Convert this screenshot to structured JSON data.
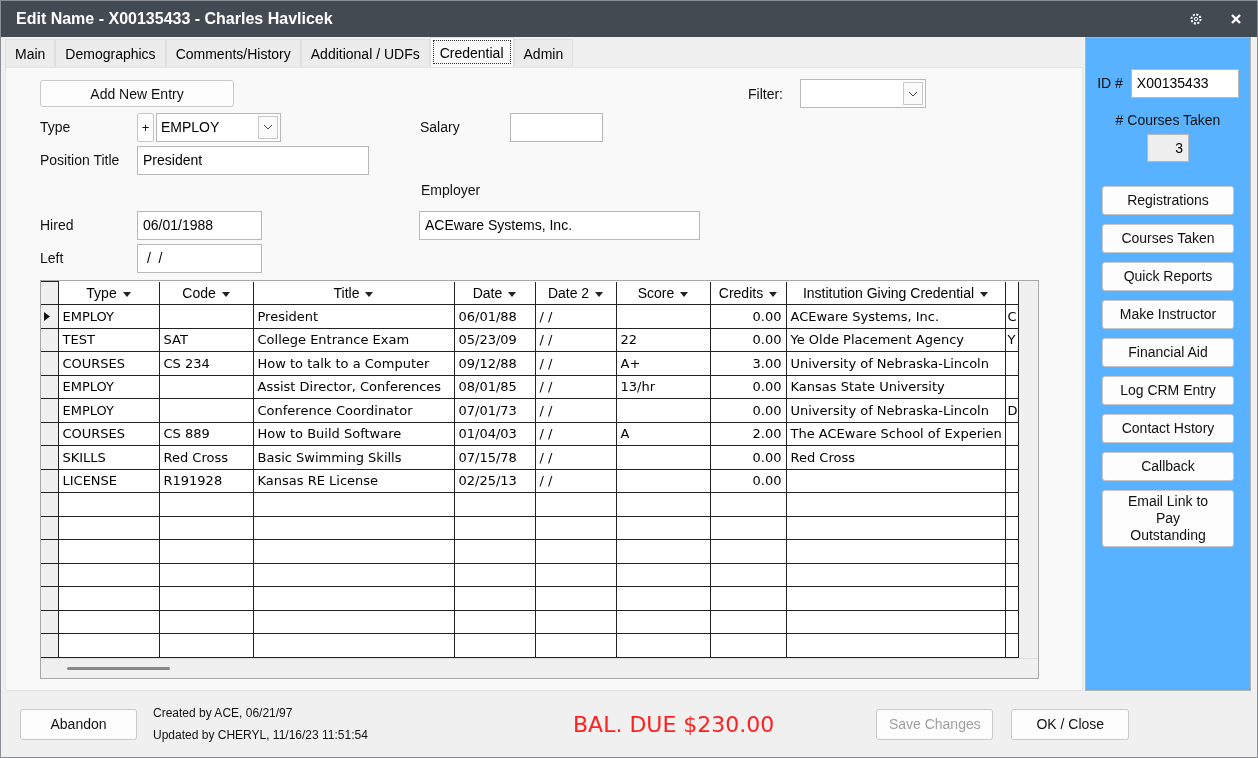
{
  "window": {
    "title": "Edit Name - X00135433 - Charles Havlicek"
  },
  "tabs": [
    {
      "label": "Main",
      "selected": false
    },
    {
      "label": "Demographics",
      "selected": false
    },
    {
      "label": "Comments/History",
      "selected": false
    },
    {
      "label": "Additional / UDFs",
      "selected": false
    },
    {
      "label": "Credential",
      "selected": true
    },
    {
      "label": "Admin",
      "selected": false
    }
  ],
  "form": {
    "add_button": "Add New Entry",
    "filter": {
      "label": "Filter:"
    },
    "type": {
      "label": "Type",
      "add": "+",
      "value": "EMPLOY"
    },
    "salary": {
      "label": "Salary"
    },
    "position_title": {
      "label": "Position Title",
      "value": "President"
    },
    "employer": {
      "label": "Employer",
      "value": "ACEware Systems, Inc."
    },
    "hired": {
      "label": "Hired",
      "value": "06/01/1988"
    },
    "left": {
      "label": "Left",
      "value": " /  /"
    }
  },
  "table": {
    "columns": [
      "Type",
      "Code",
      "Title",
      "Date",
      "Date 2",
      "Score",
      "Credits",
      "Institution Giving Credential"
    ],
    "rows": [
      {
        "selected": true,
        "cells": [
          "EMPLOY",
          "",
          "President",
          "06/01/88",
          "/  /",
          "",
          "0.00",
          "ACEware Systems, Inc.",
          "C"
        ]
      },
      {
        "selected": false,
        "cells": [
          "TEST",
          "SAT",
          "College Entrance Exam",
          "05/23/09",
          "/  /",
          "22",
          "0.00",
          "Ye Olde Placement Agency",
          "Y"
        ]
      },
      {
        "selected": false,
        "cells": [
          "COURSES",
          "CS 234",
          "How to talk to a Computer",
          "09/12/88",
          "/  /",
          "A+",
          "3.00",
          "University of Nebraska-Lincoln",
          ""
        ]
      },
      {
        "selected": false,
        "cells": [
          "EMPLOY",
          "",
          "Assist Director, Conferences",
          "08/01/85",
          "/  /",
          "13/hr",
          "0.00",
          "Kansas State University",
          ""
        ]
      },
      {
        "selected": false,
        "cells": [
          "EMPLOY",
          "",
          "Conference Coordinator",
          "07/01/73",
          "/  /",
          "",
          "0.00",
          "University of Nebraska-Lincoln",
          "D"
        ]
      },
      {
        "selected": false,
        "cells": [
          "COURSES",
          "CS 889",
          "How to Build Software",
          "01/04/03",
          "/  /",
          "A",
          "2.00",
          "The ACEware School of Experien",
          ""
        ]
      },
      {
        "selected": false,
        "cells": [
          "SKILLS",
          "Red Cross",
          "Basic Swimming Skills",
          "07/15/78",
          "/  /",
          "",
          "0.00",
          "Red Cross",
          ""
        ]
      },
      {
        "selected": false,
        "cells": [
          "LICENSE",
          "R191928",
          "Kansas RE License",
          "02/25/13",
          "/  /",
          "",
          "0.00",
          "",
          ""
        ]
      }
    ]
  },
  "side_panel": {
    "id_label": "ID #",
    "id_value": "X00135433",
    "courses_label": "# Courses Taken",
    "courses_value": "3",
    "buttons": [
      "Registrations",
      "Courses Taken",
      "Quick Reports",
      "Make Instructor",
      "Financial Aid",
      "Log CRM Entry",
      "Contact Hstory",
      "Callback",
      "Email Link to Pay Outstanding"
    ]
  },
  "footer": {
    "abandon": "Abandon",
    "created": "Created by ACE, 06/21/97",
    "updated": "Updated by CHERYL, 11/16/23 11:51:54",
    "balance": "BAL. DUE $230.00",
    "save": {
      "label": "Save Changes",
      "disabled": true
    },
    "ok": "OK / Close"
  }
}
